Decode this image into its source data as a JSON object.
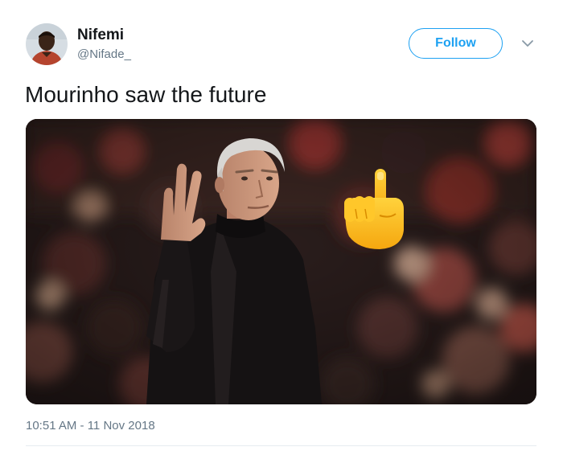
{
  "user": {
    "display_name": "Nifemi",
    "handle": "@Nifade_"
  },
  "actions": {
    "follow_label": "Follow",
    "menu_icon": "chevron-down-icon"
  },
  "tweet": {
    "text": "Mourinho saw the future",
    "timestamp": "10:51 AM - 11 Nov 2018"
  },
  "media": {
    "overlay_emoji_icon": "pointing-up-hand-icon"
  },
  "colors": {
    "accent": "#1da1f2",
    "text_primary": "#14171a",
    "text_secondary": "#657786",
    "divider": "#e6ecf0"
  }
}
